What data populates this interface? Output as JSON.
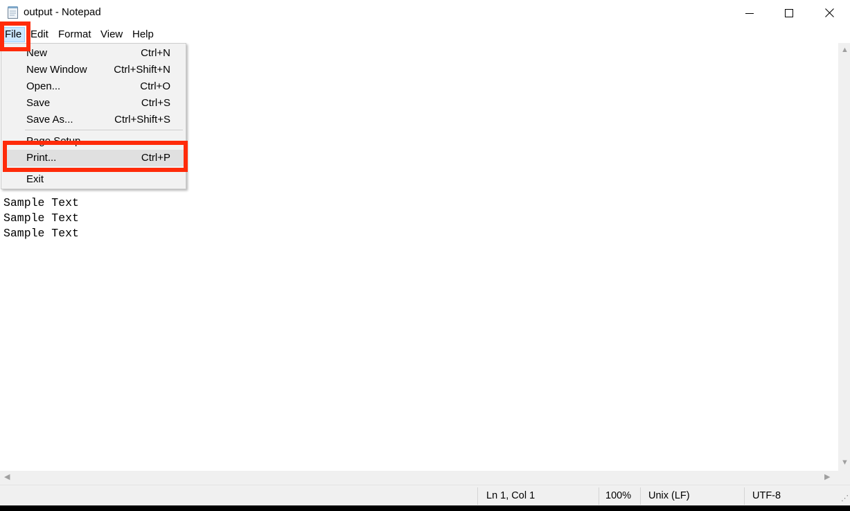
{
  "window": {
    "title": "output - Notepad",
    "app_icon": "notepad-icon",
    "controls": {
      "minimize_icon": "minimize-icon",
      "maximize_icon": "maximize-icon",
      "close_icon": "close-icon"
    }
  },
  "menubar": {
    "items": [
      {
        "label": "File",
        "active": true
      },
      {
        "label": "Edit"
      },
      {
        "label": "Format"
      },
      {
        "label": "View"
      },
      {
        "label": "Help"
      }
    ]
  },
  "file_menu": {
    "items": [
      {
        "label": "New",
        "shortcut": "Ctrl+N"
      },
      {
        "label": "New Window",
        "shortcut": "Ctrl+Shift+N"
      },
      {
        "label": "Open...",
        "shortcut": "Ctrl+O"
      },
      {
        "label": "Save",
        "shortcut": "Ctrl+S"
      },
      {
        "label": "Save As...",
        "shortcut": "Ctrl+Shift+S"
      },
      {
        "label": "Page Setup...",
        "shortcut": ""
      },
      {
        "label": "Print...",
        "shortcut": "Ctrl+P",
        "highlighted": true
      },
      {
        "label": "Exit",
        "shortcut": ""
      }
    ]
  },
  "editor": {
    "text": "\n\n\n\n\n\n\n\nSample Text\n\nSample Text\nSample Text\nSample Text"
  },
  "statusbar": {
    "position": "Ln 1, Col 1",
    "zoom": "100%",
    "line_ending": "Unix (LF)",
    "encoding": "UTF-8"
  },
  "colors": {
    "highlight_box": "#ff2b0a",
    "menu_active_bg": "#cce8ff",
    "dropdown_bg": "#f2f2f2"
  }
}
